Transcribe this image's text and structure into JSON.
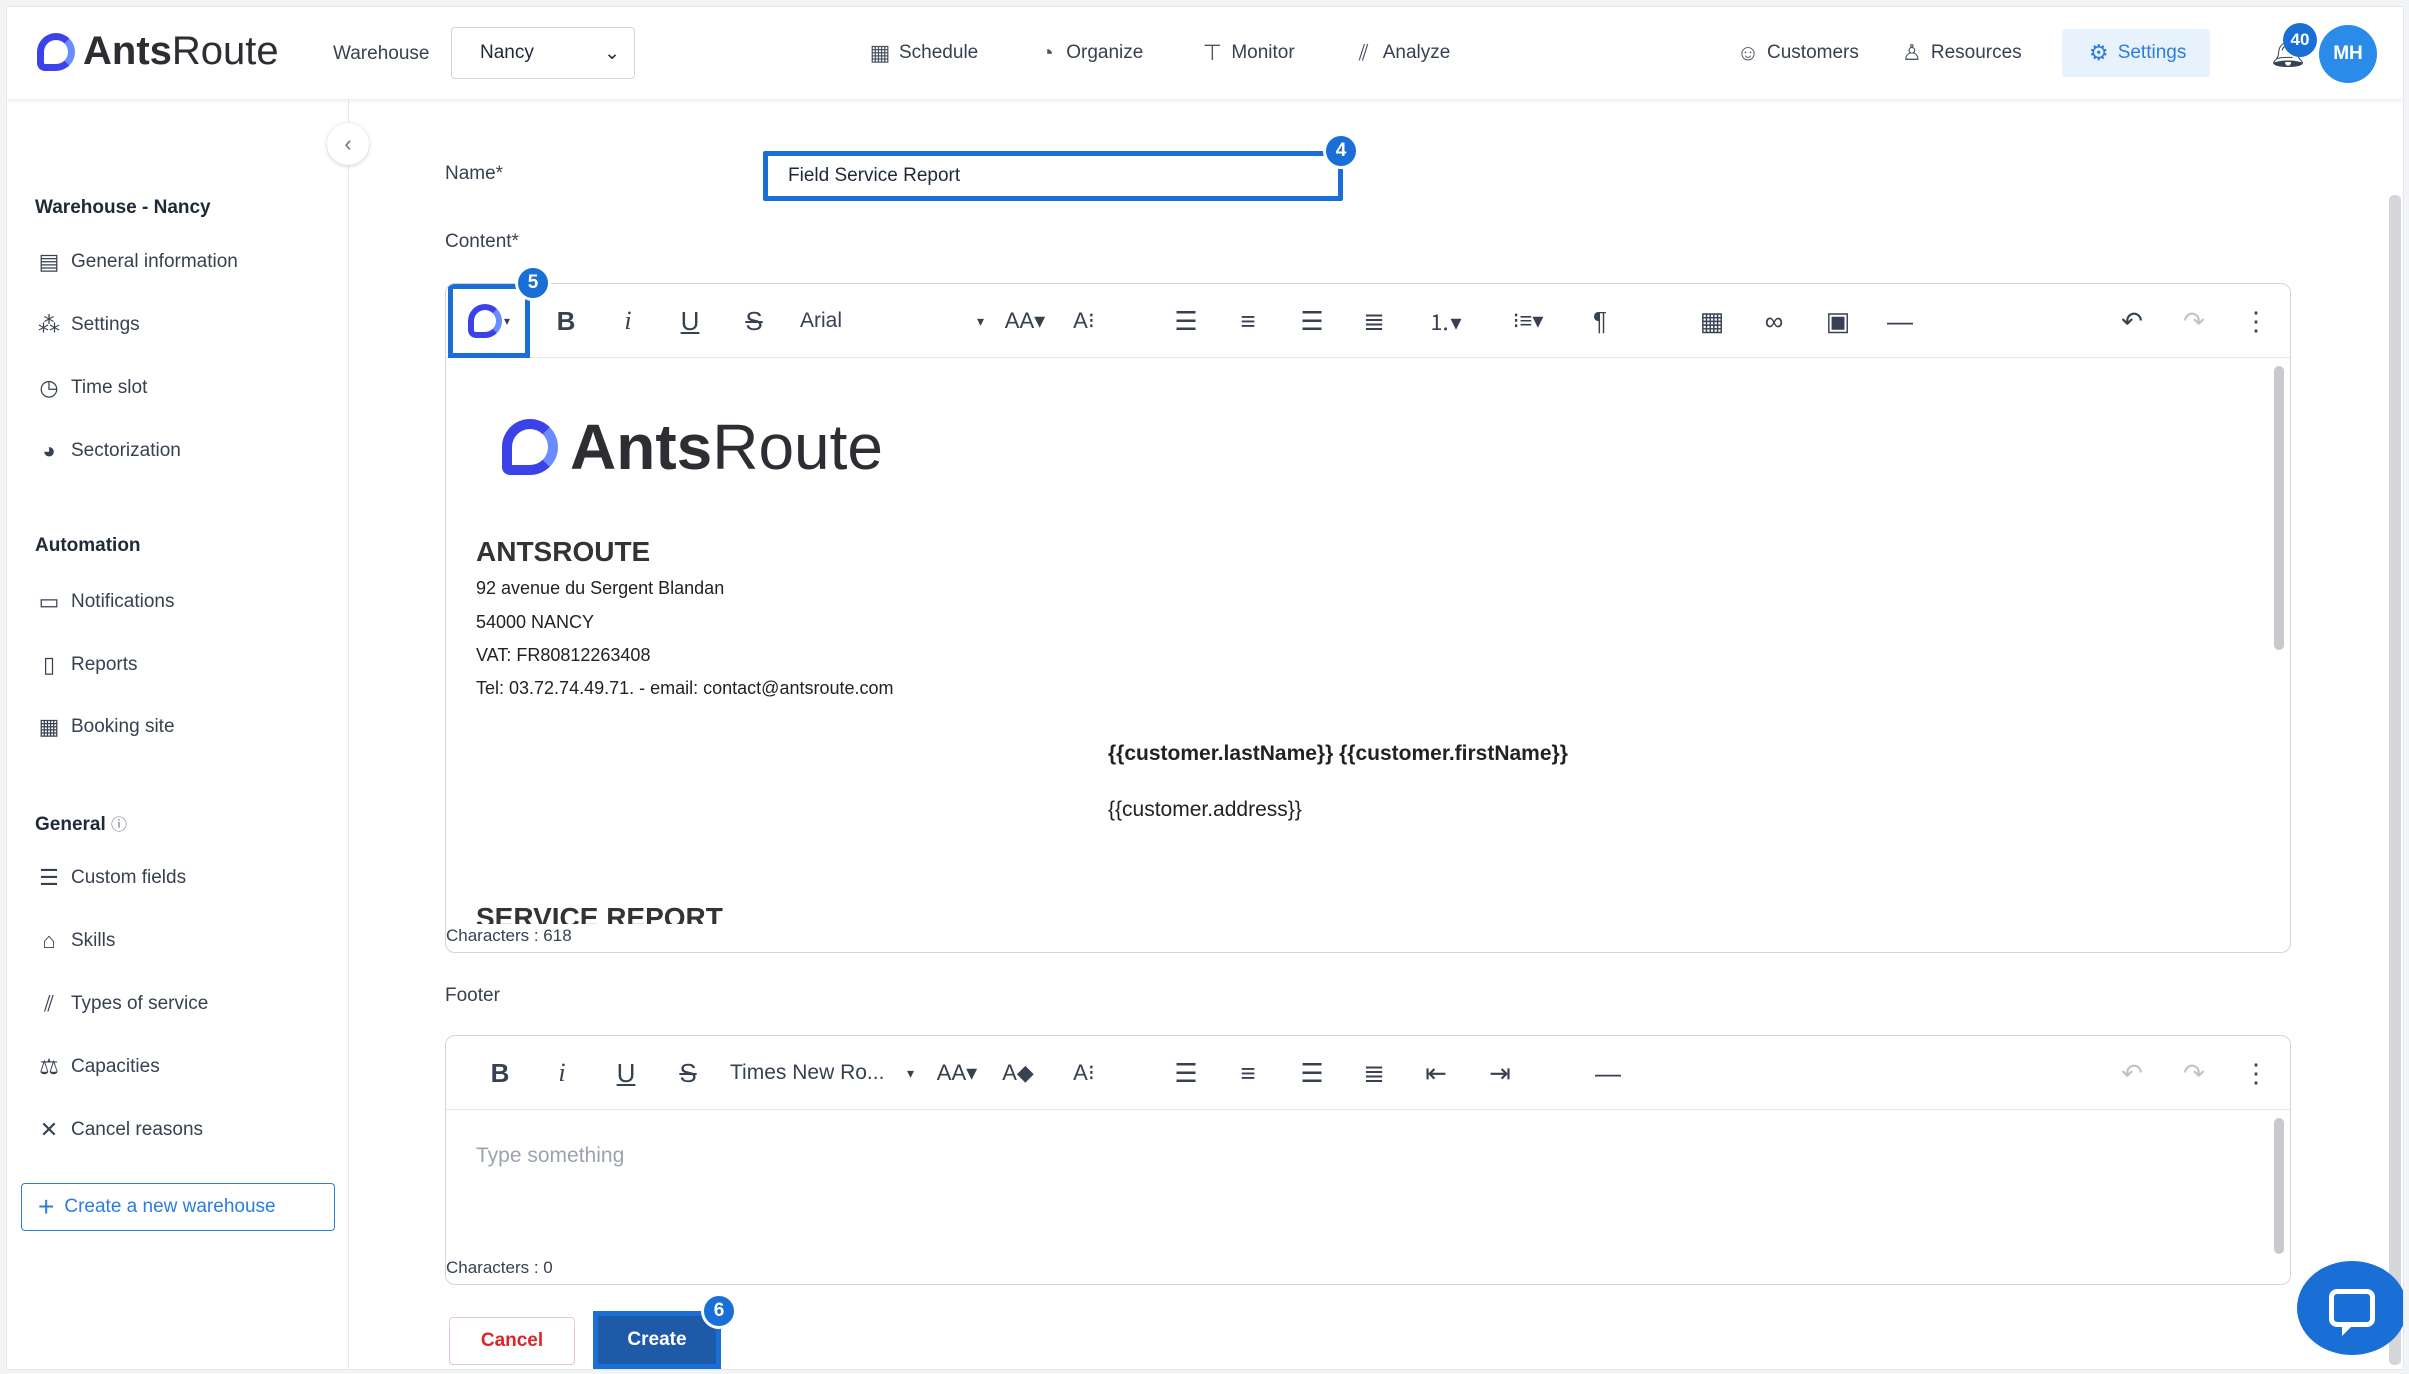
{
  "header": {
    "logo_bold": "Ants",
    "logo_light": "Route",
    "warehouse_label": "Warehouse",
    "warehouse_value": "Nancy",
    "nav": [
      {
        "label": "Schedule",
        "icon": "calendar-icon"
      },
      {
        "label": "Organize",
        "icon": "gauge-icon"
      },
      {
        "label": "Monitor",
        "icon": "signpost-icon"
      },
      {
        "label": "Analyze",
        "icon": "chart-icon"
      }
    ],
    "nav_right": [
      {
        "label": "Customers",
        "icon": "customers-icon"
      },
      {
        "label": "Resources",
        "icon": "resources-icon"
      },
      {
        "label": "Settings",
        "icon": "gear-icon"
      }
    ],
    "notifications_count": "40",
    "avatar_initials": "MH"
  },
  "sidebar": {
    "section_warehouse": "Warehouse - Nancy",
    "warehouse_items": [
      {
        "label": "General information",
        "icon": "building-icon"
      },
      {
        "label": "Settings",
        "icon": "settings-icon"
      },
      {
        "label": "Time slot",
        "icon": "clock-icon"
      },
      {
        "label": "Sectorization",
        "icon": "pie-icon"
      }
    ],
    "section_automation": "Automation",
    "automation_items": [
      {
        "label": "Notifications",
        "icon": "message-icon"
      },
      {
        "label": "Reports",
        "icon": "document-icon"
      },
      {
        "label": "Booking site",
        "icon": "calendar-icon"
      }
    ],
    "section_general": "General",
    "general_items": [
      {
        "label": "Custom fields",
        "icon": "list-icon"
      },
      {
        "label": "Skills",
        "icon": "graduation-cap-icon"
      },
      {
        "label": "Types of service",
        "icon": "chart-icon"
      },
      {
        "label": "Capacities",
        "icon": "scale-icon"
      },
      {
        "label": "Cancel reasons",
        "icon": "close-icon"
      }
    ],
    "create_warehouse": "Create a new warehouse"
  },
  "form": {
    "name_label": "Name*",
    "name_value": "Field Service Report",
    "content_label": "Content*",
    "font_name": "Arial",
    "content_chars": "Characters : 618",
    "footer_label": "Footer",
    "footer_font": "Times New Ro...",
    "footer_placeholder": "Type something",
    "footer_chars": "Characters : 0",
    "cancel_label": "Cancel",
    "create_label": "Create"
  },
  "document": {
    "logo_bold": "Ants",
    "logo_light": "Route",
    "company": "ANTSROUTE",
    "address": "92 avenue du Sergent Blandan",
    "city": "54000 NANCY",
    "vat": "VAT: FR80812263408",
    "contact": "Tel: 03.72.74.49.71. - email: contact@antsroute.com",
    "customer_name_var": "{{customer.lastName}} {{customer.firstName}}",
    "customer_address_var": "{{customer.address}}",
    "report_title": "SERVICE REPORT"
  },
  "steps": {
    "s4": "4",
    "s5": "5",
    "s6": "6"
  },
  "colors": {
    "accent": "#1a6fd6",
    "brand": "#3b42e8",
    "danger": "#dc2626"
  }
}
